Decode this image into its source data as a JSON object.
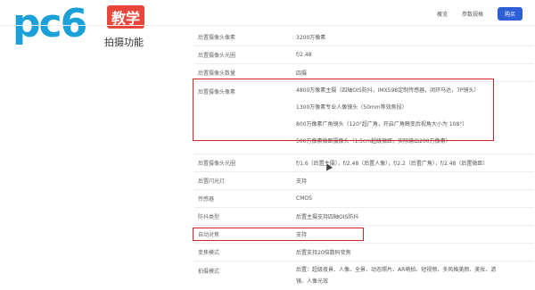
{
  "logo": {
    "text": "pc6",
    "badge": "教学"
  },
  "section_title": "拍摄功能",
  "nav": {
    "items": [
      "概览",
      "参数规格"
    ],
    "buy": "购买"
  },
  "rows": [
    {
      "label": "后置摄像头像素",
      "values": [
        "3200万像素"
      ]
    },
    {
      "label": "后置摄像头光圈",
      "values": [
        "f/2.48"
      ]
    },
    {
      "label": "后置摄像头数量",
      "values": [
        "四摄"
      ]
    },
    {
      "label": "后置摄像头像素",
      "values": [
        "4800万像素主摄（四轴OIS防抖，IMX598定制传感器，闭环马达，7P镜头）",
        "1300万像素专业人像镜头（50mm等效焦段）",
        "800万像素广角镜头（120°超广角，开启广角畸变后视角大小为 108°）",
        "500万像素微距摄像头（1.5cm超级微距，实际输出200万像素）"
      ]
    },
    {
      "label": "后置摄像头光圈",
      "values": [
        "f/1.6（后置主摄），f/2.48（后置人像），f/2.2（后置广角），f/2.48（后置微距）"
      ]
    },
    {
      "label": "后置闪光灯",
      "values": [
        "支持"
      ]
    },
    {
      "label": "传感器",
      "values": [
        "CMOS"
      ]
    },
    {
      "label": "防抖类型",
      "values": [
        "后置主摄支持四轴OIS防抖"
      ]
    },
    {
      "label": "自动对焦",
      "values": [
        "支持"
      ]
    },
    {
      "label": "变焦模式",
      "values": [
        "后置支持20倍数码变焦"
      ]
    },
    {
      "label": "拍摄模式",
      "values": [
        "后置：超级夜景、人像、全景、动态照片、AR萌拍、短视频、多风格美颜、美妆、滤",
        "镜、人像光效"
      ]
    }
  ]
}
